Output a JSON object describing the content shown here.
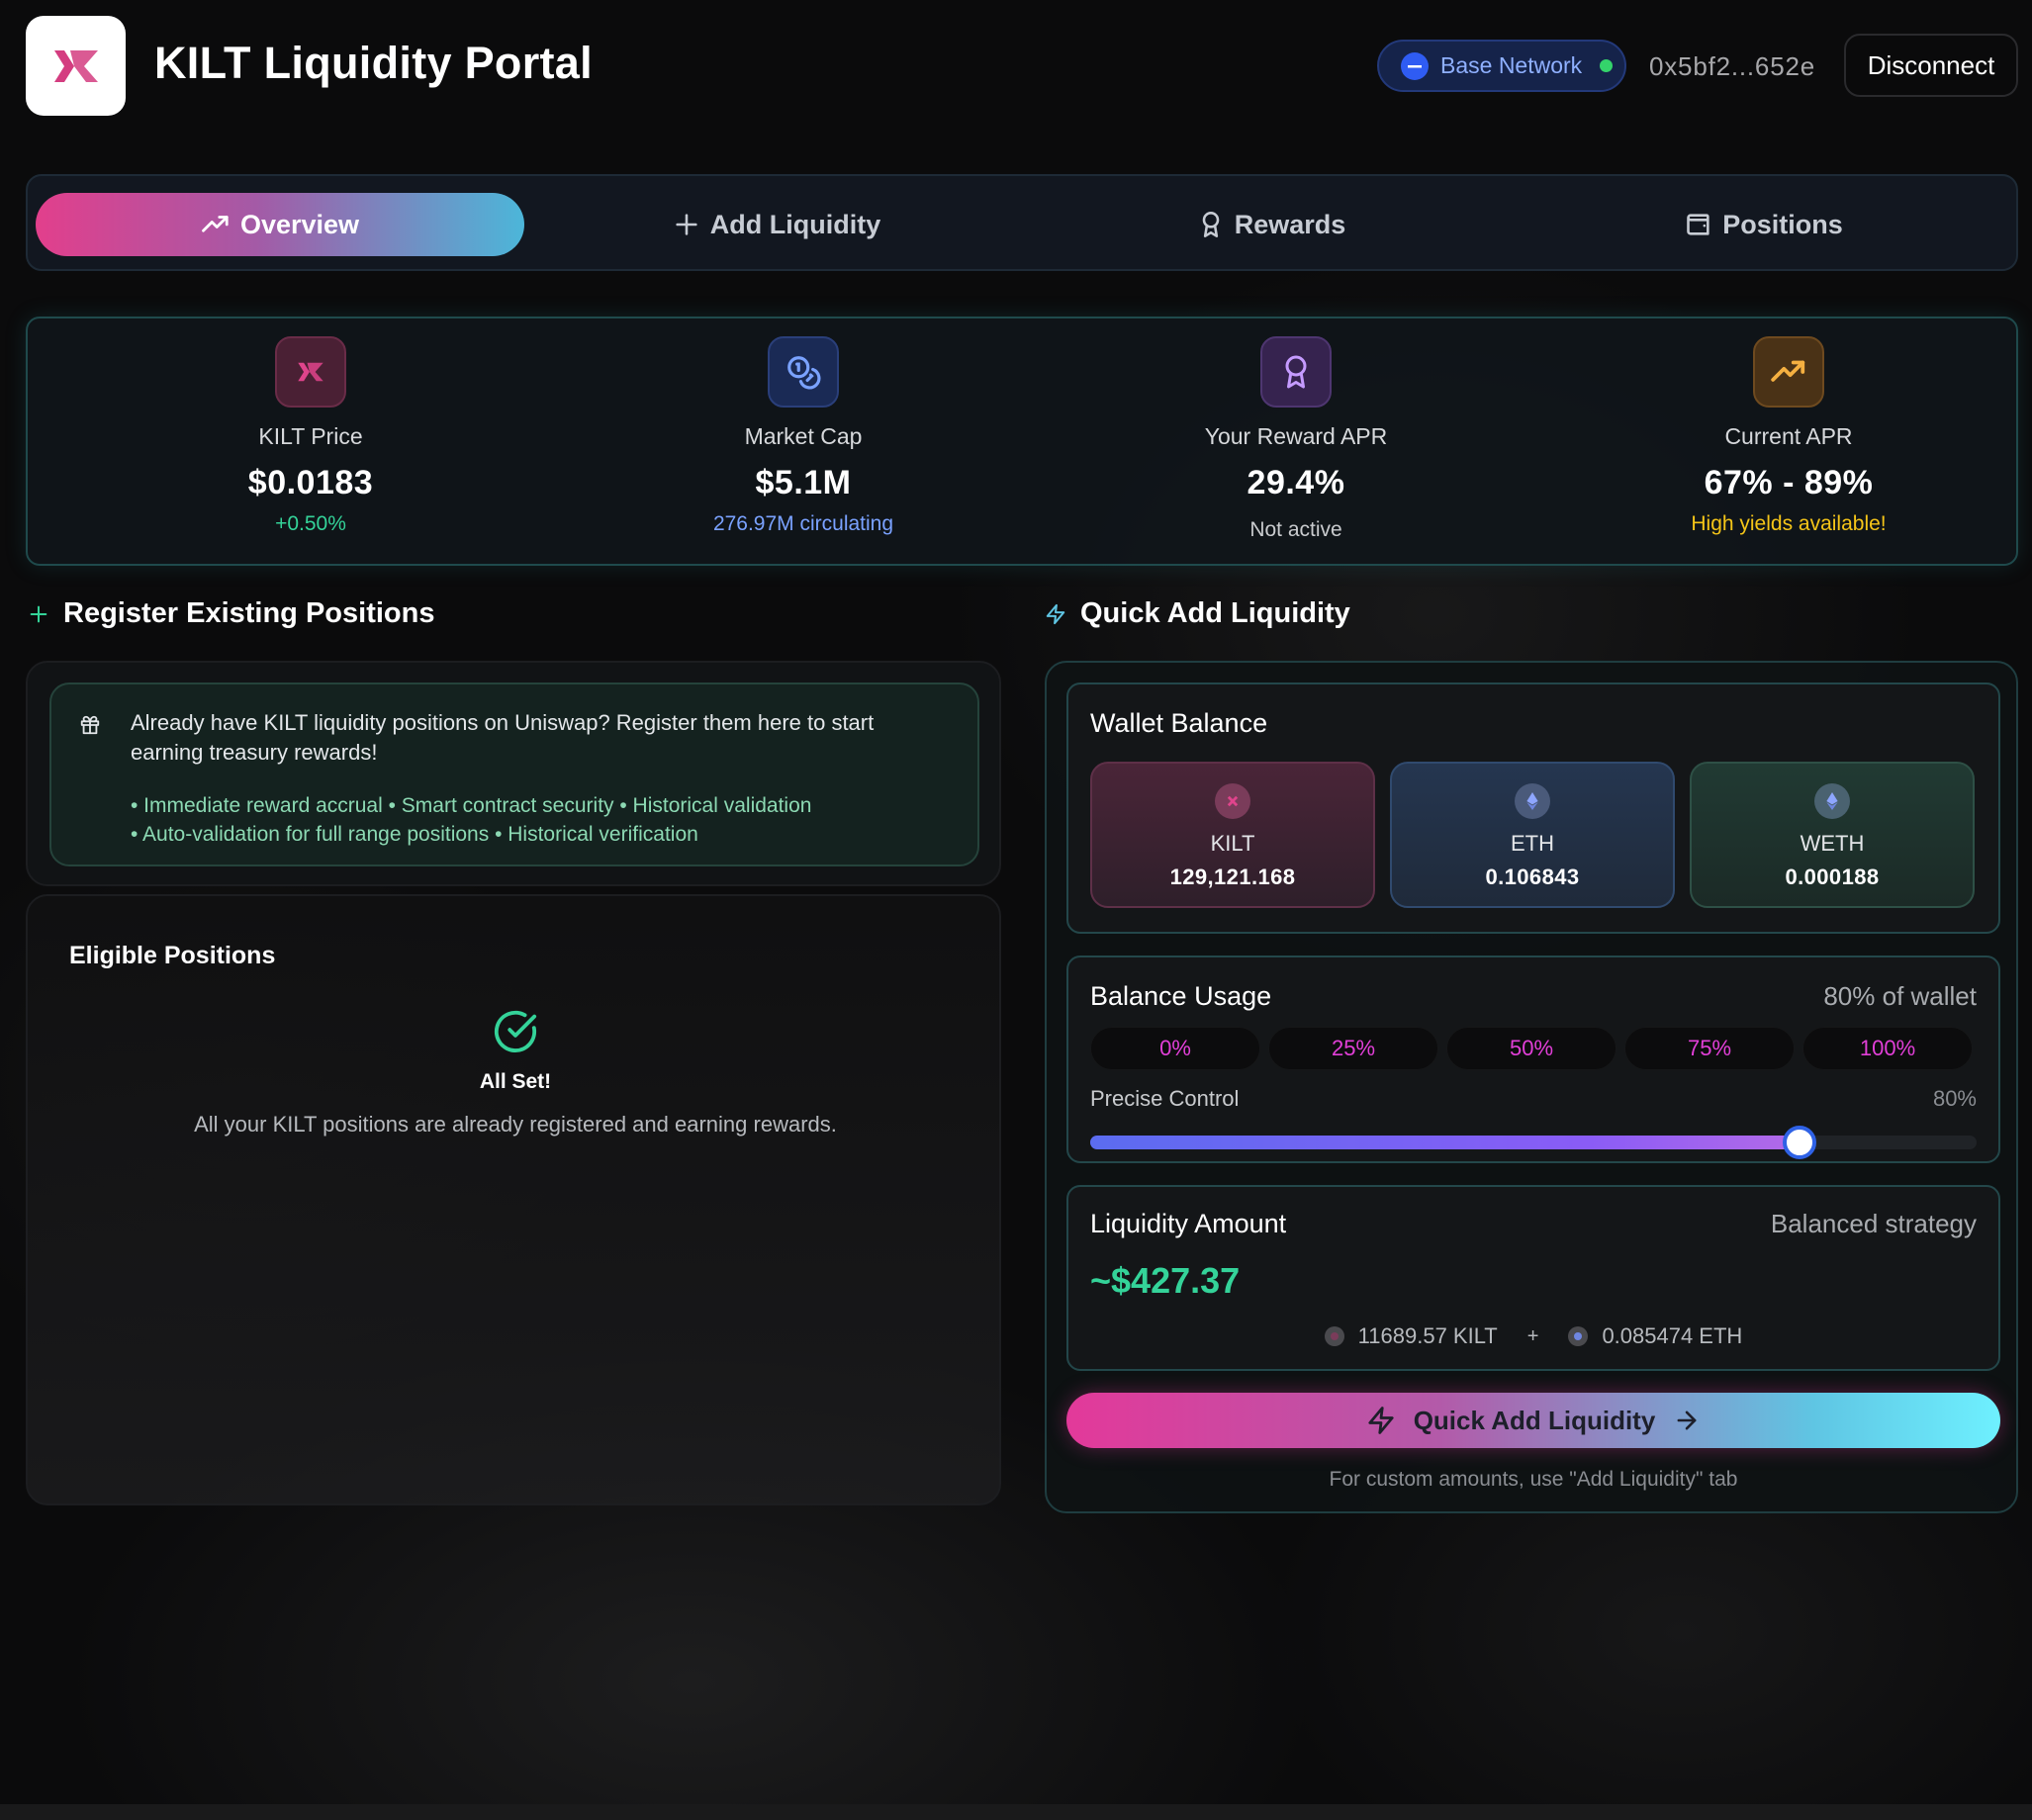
{
  "header": {
    "app_title": "KILT Liquidity Portal",
    "logo_icon": "kilt-logo-icon",
    "network_label": "Base Network",
    "wallet_address": "0x5bf2...652e",
    "disconnect_label": "Disconnect"
  },
  "tabs": [
    {
      "label": "Overview",
      "icon": "trending-up-icon",
      "active": true
    },
    {
      "label": "Add Liquidity",
      "icon": "plus-icon",
      "active": false
    },
    {
      "label": "Rewards",
      "icon": "award-icon",
      "active": false
    },
    {
      "label": "Positions",
      "icon": "wallet-icon",
      "active": false
    }
  ],
  "stats": [
    {
      "label": "KILT Price",
      "value": "$0.0183",
      "sub": "+0.50%",
      "icon": "kilt-logo-icon"
    },
    {
      "label": "Market Cap",
      "value": "$5.1M",
      "sub": "276.97M circulating",
      "icon": "coins-icon"
    },
    {
      "label": "Your Reward APR",
      "value": "29.4%",
      "sub": "Not active",
      "icon": "award-icon"
    },
    {
      "label": "Current APR",
      "value": "67% - 89%",
      "sub": "High yields available!",
      "icon": "trending-up-icon"
    }
  ],
  "register": {
    "heading": "Register Existing Positions",
    "message": "Already have KILT liquidity positions on Uniswap? Register them here to start earning treasury rewards!",
    "bullets_line1": "• Immediate reward accrual • Smart contract security • Historical validation",
    "bullets_line2": "• Auto-validation for full range positions • Historical verification"
  },
  "eligible": {
    "title": "Eligible Positions",
    "status_title": "All Set!",
    "status_desc": "All your KILT positions are already registered and earning rewards."
  },
  "quick_add": {
    "heading": "Quick Add Liquidity",
    "wallet_balance_title": "Wallet Balance",
    "tokens": [
      {
        "name": "KILT",
        "balance": "129,121.168"
      },
      {
        "name": "ETH",
        "balance": "0.106843"
      },
      {
        "name": "WETH",
        "balance": "0.000188"
      }
    ],
    "balance_usage_title": "Balance Usage",
    "balance_usage_value": "80% of wallet",
    "percent_options": [
      "0%",
      "25%",
      "50%",
      "75%",
      "100%"
    ],
    "precise_label": "Precise Control",
    "precise_value": "80%",
    "slider_fraction": 0.8,
    "liquidity_title": "Liquidity Amount",
    "strategy": "Balanced strategy",
    "amount": "~$427.37",
    "kilt_amount": "11689.57 KILT",
    "plus": "+",
    "eth_amount": "0.085474 ETH",
    "button_label": "Quick Add Liquidity",
    "note": "For custom amounts, use \"Add Liquidity\" tab"
  },
  "colors": {
    "accent_pink": "#e23f8c",
    "accent_cyan": "#4cb6d9",
    "positive_green": "#34d399",
    "warning_yellow": "#f5c518",
    "percent_magenta": "#e23fd8"
  }
}
